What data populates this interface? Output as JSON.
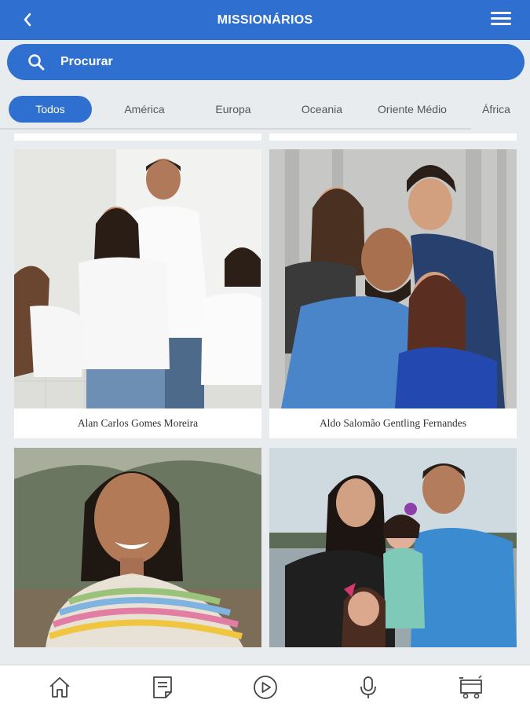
{
  "header": {
    "title": "MISSIONÁRIOS",
    "back_icon": "chevron-left-icon",
    "menu_icon": "hamburger-menu-icon"
  },
  "search": {
    "label": "Procurar",
    "icon": "search-icon"
  },
  "tabs": [
    {
      "label": "Todos",
      "active": true
    },
    {
      "label": "América"
    },
    {
      "label": "Europa"
    },
    {
      "label": "Oceania"
    },
    {
      "label": "Oriente Médio"
    },
    {
      "label": "África"
    }
  ],
  "cards": [
    {
      "name": "Alan Carlos Gomes Moreira",
      "photo": "family-photo"
    },
    {
      "name": "Aldo Salomão Gentling Fernandes",
      "photo": "family-photo"
    },
    {
      "name": "",
      "photo": "portrait-photo"
    },
    {
      "name": "",
      "photo": "family-photo"
    }
  ],
  "bottom_nav": [
    "home-icon",
    "notes-icon",
    "play-icon",
    "microphone-icon",
    "cart-icon"
  ],
  "colors": {
    "primary": "#2f6fd0",
    "background": "#e9ecef"
  }
}
